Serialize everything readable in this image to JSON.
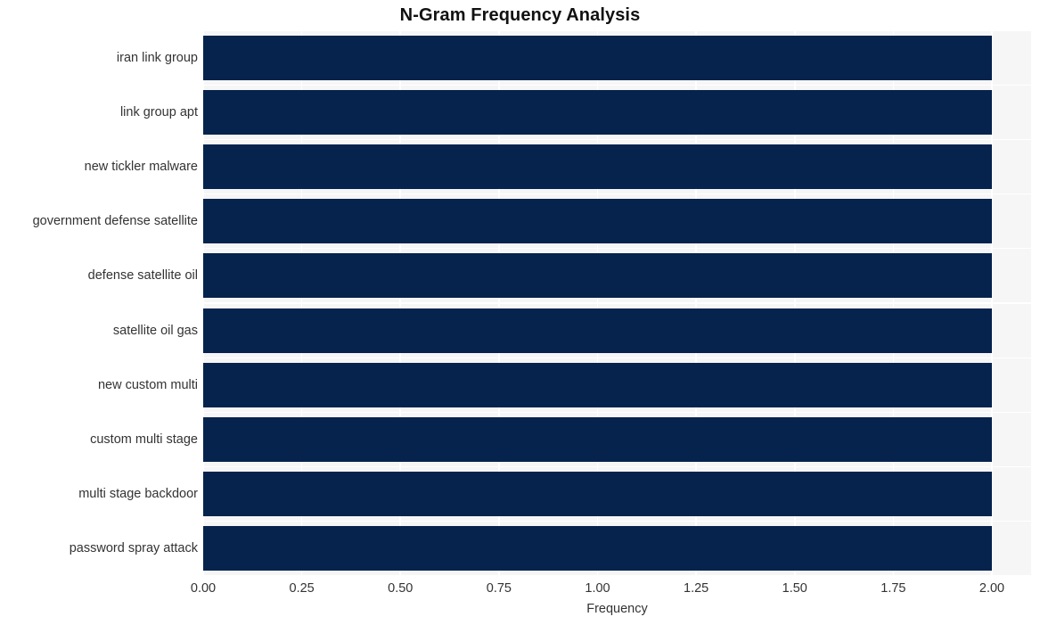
{
  "chart_data": {
    "type": "bar",
    "orientation": "horizontal",
    "title": "N-Gram Frequency Analysis",
    "xlabel": "Frequency",
    "ylabel": "",
    "categories": [
      "iran link group",
      "link group apt",
      "new tickler malware",
      "government defense satellite",
      "defense satellite oil",
      "satellite oil gas",
      "new custom multi",
      "custom multi stage",
      "multi stage backdoor",
      "password spray attack"
    ],
    "values": [
      2,
      2,
      2,
      2,
      2,
      2,
      2,
      2,
      2,
      2
    ],
    "xlim": [
      0,
      2
    ],
    "xticks": [
      0,
      0.25,
      0.5,
      0.75,
      1,
      1.25,
      1.5,
      1.75,
      2
    ],
    "xticklabels": [
      "0.00",
      "0.25",
      "0.50",
      "0.75",
      "1.00",
      "1.25",
      "1.50",
      "1.75",
      "2.00"
    ],
    "grid": true,
    "legend": false,
    "bar_color": "#05234d",
    "plot_background": "#f6f6f6",
    "grid_color": "#ffffff",
    "text_color": "#333333",
    "title_color": "#111111"
  }
}
